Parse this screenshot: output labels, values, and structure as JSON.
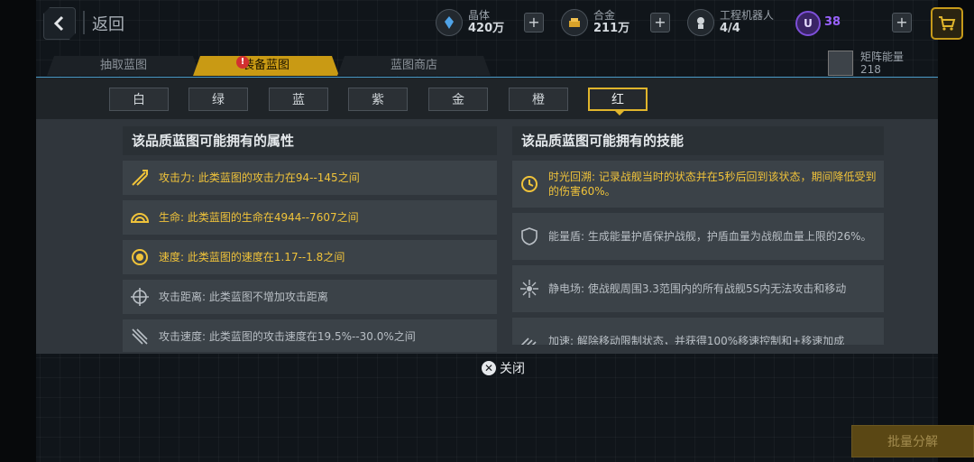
{
  "topbar": {
    "back_label": "返回",
    "resources": [
      {
        "label": "晶体",
        "value": "420万",
        "icon": "crystal-icon"
      },
      {
        "label": "合金",
        "value": "211万",
        "icon": "alloy-icon"
      },
      {
        "label": "工程机器人",
        "value": "4/4",
        "icon": "robot-icon"
      }
    ],
    "u_badge": "U",
    "u_value": "38",
    "plus": "+"
  },
  "tabs": [
    {
      "label": "抽取蓝图"
    },
    {
      "label": "装备蓝图",
      "alert": "!"
    },
    {
      "label": "蓝图商店"
    }
  ],
  "energy": {
    "label": "矩阵能量",
    "value": "218"
  },
  "quality_tabs": [
    "白",
    "绿",
    "蓝",
    "紫",
    "金",
    "橙",
    "红"
  ],
  "active_quality": "红",
  "attributes": {
    "title": "该品质蓝图可能拥有的属性",
    "items": [
      {
        "text": "攻击力: 此类蓝图的攻击力在94--145之间",
        "icon": "attack-icon",
        "color": "#f0c33a"
      },
      {
        "text": "生命: 此类蓝图的生命在4944--7607之间",
        "icon": "health-icon",
        "color": "#f0c33a"
      },
      {
        "text": "速度: 此类蓝图的速度在1.17--1.8之间",
        "icon": "speed-icon",
        "color": "#f0c33a"
      },
      {
        "text": "攻击距离: 此类蓝图不增加攻击距离",
        "icon": "crosshair-icon",
        "color": "#b9bfc5"
      },
      {
        "text": "攻击速度: 此类蓝图的攻击速度在19.5%--30.0%之间",
        "icon": "attack-speed-icon",
        "color": "#b9bfc5"
      }
    ]
  },
  "skills": {
    "title": "该品质蓝图可能拥有的技能",
    "items": [
      {
        "text": "时光回溯: 记录战舰当时的状态并在5秒后回到该状态，期间降低受到的伤害60%。",
        "icon": "time-rewind-icon",
        "color": "#f0c33a"
      },
      {
        "text": "能量盾: 生成能量护盾保护战舰，护盾血量为战舰血量上限的26%。",
        "icon": "energy-shield-icon",
        "color": "#b9bfc5"
      },
      {
        "text": "静电场: 使战舰周围3.3范围内的所有战舰5S内无法攻击和移动",
        "icon": "static-field-icon",
        "color": "#b9bfc5"
      },
      {
        "text": "加速: 解除移动限制状态，并获得100%移速控制和+移速加成",
        "icon": "boost-icon",
        "color": "#b9bfc5"
      }
    ]
  },
  "close_label": "关闭",
  "bulk_label": "批量分解"
}
